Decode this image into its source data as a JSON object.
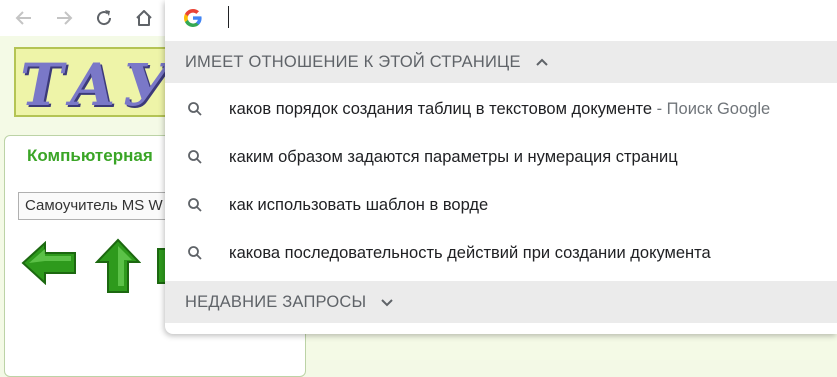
{
  "toolbar": {
    "back_icon": "back-arrow-icon",
    "forward_icon": "forward-arrow-icon",
    "reload_icon": "reload-icon",
    "home_icon": "home-icon"
  },
  "page": {
    "banner_logo": "ТАУ",
    "panel_title": "Компьютерная",
    "select_value": "Самоучитель MS W"
  },
  "omnibox": {
    "input_value": "",
    "related_header": "ИМЕЕТ ОТНОШЕНИЕ К ЭТОЙ СТРАНИЦЕ",
    "suggestions": [
      {
        "text": "каков порядок создания таблиц в текстовом документе",
        "sep": " - ",
        "source": "Поиск Google"
      },
      {
        "text": "каким образом задаются параметры и нумерация страниц"
      },
      {
        "text": "как использовать шаблон в ворде"
      },
      {
        "text": "какова последовательность действий при создании документа"
      }
    ],
    "recent_header": "НЕДАВНИЕ ЗАПРОСЫ"
  },
  "colors": {
    "page_bg": "#f4fae6",
    "panel_title": "#3aa526",
    "arrow_green": "#2e9a1c",
    "section_bg": "#ebebeb"
  }
}
